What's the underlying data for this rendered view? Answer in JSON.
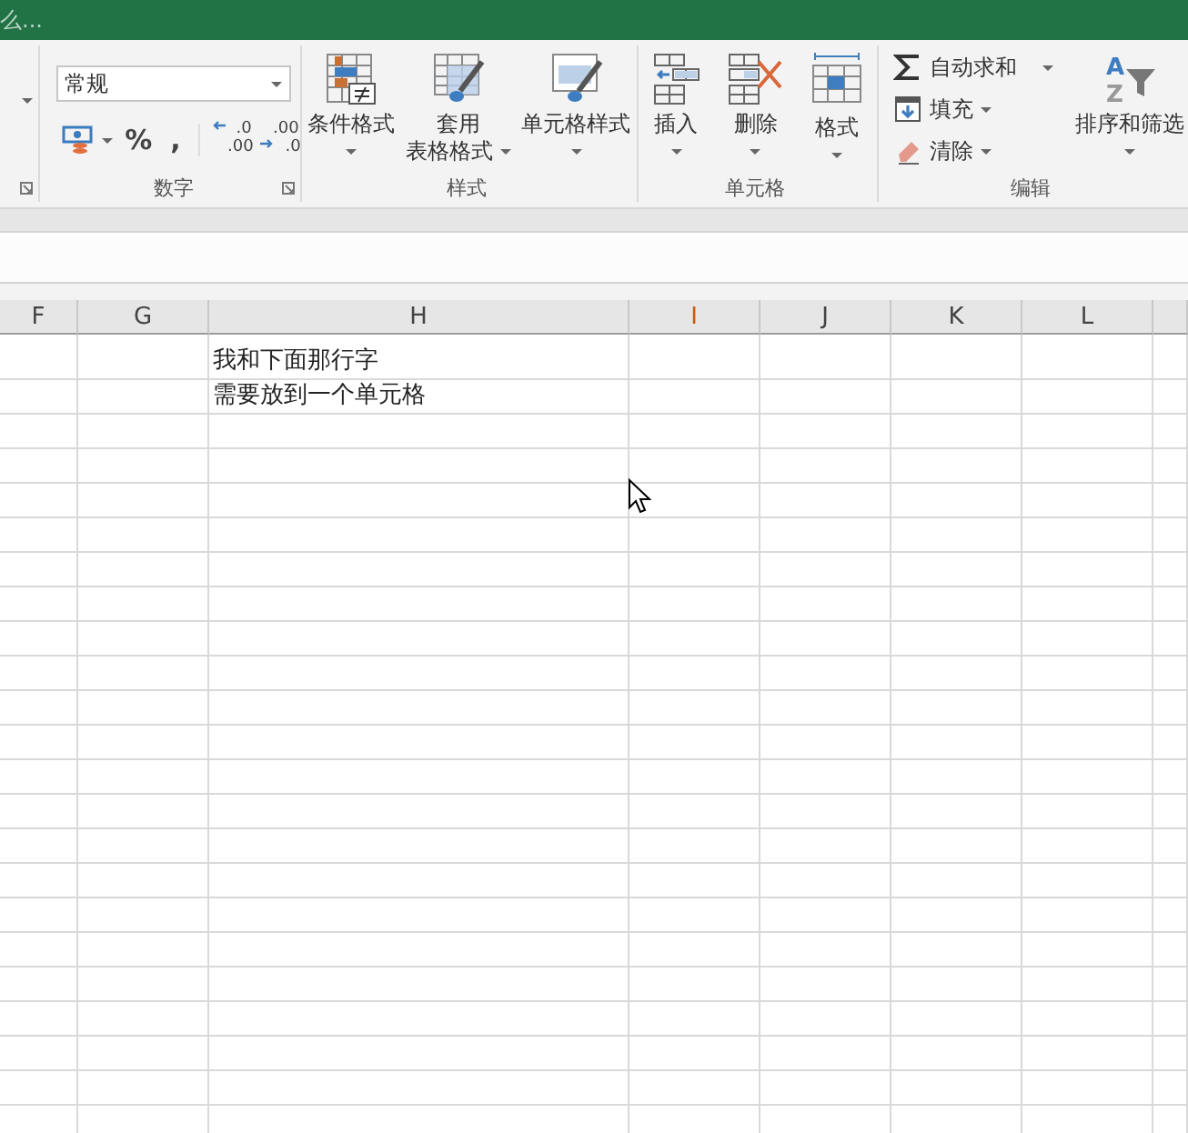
{
  "title_bar": {
    "text": "么..."
  },
  "ribbon": {
    "number": {
      "label": "数字",
      "format_combo": {
        "value": "常规"
      },
      "percent": "%",
      "comma": ",",
      "increase_decimal": {
        "top": ".0",
        "bottom": ".00"
      },
      "decrease_decimal": {
        "top": ".00",
        "bottom": ".0"
      }
    },
    "styles": {
      "label": "样式",
      "buttons": [
        {
          "kind": "conditional",
          "lines": [
            "条件格式"
          ]
        },
        {
          "kind": "table",
          "lines": [
            "套用",
            "表格格式"
          ]
        },
        {
          "kind": "cellstyle",
          "lines": [
            "单元格样式"
          ]
        }
      ]
    },
    "cells": {
      "label": "单元格",
      "buttons": [
        {
          "kind": "insert",
          "lines": [
            "插入"
          ]
        },
        {
          "kind": "delete",
          "lines": [
            "删除"
          ]
        },
        {
          "kind": "format",
          "lines": [
            "格式"
          ]
        }
      ]
    },
    "editing": {
      "label": "编辑",
      "small_buttons": [
        {
          "kind": "sum",
          "label": "自动求和"
        },
        {
          "kind": "fill",
          "label": "填充"
        },
        {
          "kind": "clear",
          "label": "清除"
        }
      ],
      "sort": {
        "label": "排序和筛选",
        "icon_top": "A",
        "icon_bottom": "Z"
      }
    }
  },
  "sheet": {
    "columns": [
      {
        "label": "F",
        "highlighted": false
      },
      {
        "label": "G",
        "highlighted": false
      },
      {
        "label": "H",
        "highlighted": false,
        "cells": [
          "我和下面那行字",
          "需要放到一个单元格"
        ]
      },
      {
        "label": "I",
        "highlighted": true
      },
      {
        "label": "J",
        "highlighted": false
      },
      {
        "label": "K",
        "highlighted": false
      },
      {
        "label": "L",
        "highlighted": false
      }
    ]
  }
}
